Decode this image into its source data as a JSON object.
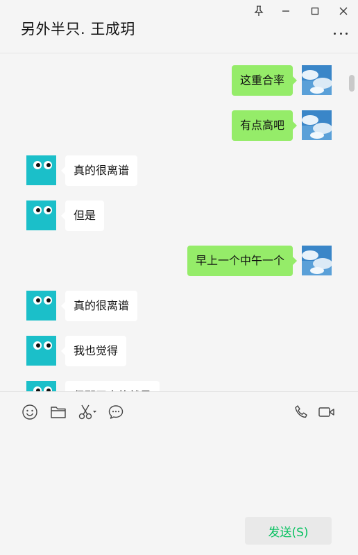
{
  "header": {
    "title": "另外半只. 王成玥"
  },
  "messages": [
    {
      "sender": "me",
      "text": "这重合率"
    },
    {
      "sender": "me",
      "text": "有点高吧"
    },
    {
      "sender": "other",
      "text": "真的很离谱"
    },
    {
      "sender": "other",
      "text": "但是"
    },
    {
      "sender": "me",
      "text": "早上一个中午一个"
    },
    {
      "sender": "other",
      "text": "真的很离谱"
    },
    {
      "sender": "other",
      "text": "我也觉得"
    },
    {
      "sender": "other",
      "text": "但那天真的就是"
    }
  ],
  "composer": {
    "send_label": "发送(S)",
    "input_value": ""
  },
  "icons": {
    "pin": "pin-icon",
    "minimize": "minimize-icon",
    "maximize": "maximize-icon",
    "close": "close-icon",
    "more": "more-icon",
    "emoji": "emoji-icon",
    "folder": "folder-icon",
    "scissors": "scissors-icon",
    "chat": "chat-bubble-icon",
    "phone": "phone-icon",
    "video": "video-icon"
  },
  "colors": {
    "self_bubble": "#95ec69",
    "other_bubble": "#ffffff",
    "send_text": "#07c160",
    "background": "#f5f5f5",
    "other_avatar": "#1bbfc9"
  }
}
